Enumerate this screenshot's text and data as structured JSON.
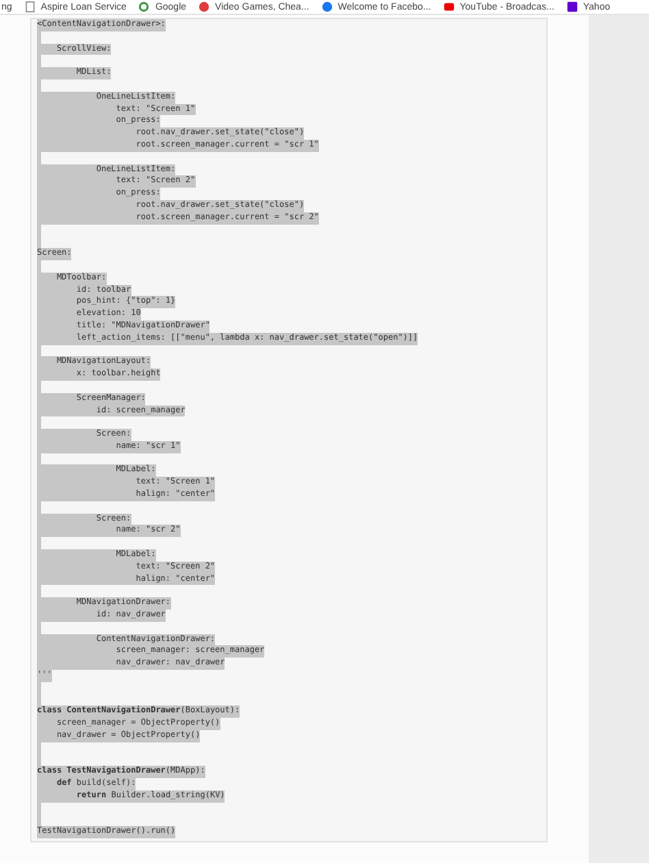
{
  "bookmarks_bar": {
    "items": [
      {
        "label": "ng"
      },
      {
        "label": "Aspire Loan Service"
      },
      {
        "label": "Google"
      },
      {
        "label": "Video Games, Chea..."
      },
      {
        "label": "Welcome to Facebo..."
      },
      {
        "label": "YouTube - Broadcas..."
      },
      {
        "label": "Yahoo"
      }
    ]
  },
  "code_block": {
    "lines": [
      {
        "kind": "code",
        "text": "<ContentNavigationDrawer>:"
      },
      {
        "kind": "blank"
      },
      {
        "kind": "code",
        "text": "    ScrollView:"
      },
      {
        "kind": "blank"
      },
      {
        "kind": "code",
        "text": "        MDList:"
      },
      {
        "kind": "blank"
      },
      {
        "kind": "code",
        "text": "            OneLineListItem:"
      },
      {
        "kind": "code",
        "text": "                text: \"Screen 1\""
      },
      {
        "kind": "code",
        "text": "                on_press:"
      },
      {
        "kind": "code",
        "text": "                    root.nav_drawer.set_state(\"close\")"
      },
      {
        "kind": "code",
        "text": "                    root.screen_manager.current = \"scr 1\""
      },
      {
        "kind": "blank"
      },
      {
        "kind": "code",
        "text": "            OneLineListItem:"
      },
      {
        "kind": "code",
        "text": "                text: \"Screen 2\""
      },
      {
        "kind": "code",
        "text": "                on_press:"
      },
      {
        "kind": "code",
        "text": "                    root.nav_drawer.set_state(\"close\")"
      },
      {
        "kind": "code",
        "text": "                    root.screen_manager.current = \"scr 2\""
      },
      {
        "kind": "blank"
      },
      {
        "kind": "blank"
      },
      {
        "kind": "code",
        "text": "Screen:"
      },
      {
        "kind": "blank"
      },
      {
        "kind": "code",
        "text": "    MDToolbar:"
      },
      {
        "kind": "code",
        "text": "        id: toolbar"
      },
      {
        "kind": "code",
        "text": "        pos_hint: {\"top\": 1}"
      },
      {
        "kind": "code",
        "text": "        elevation: 10"
      },
      {
        "kind": "code",
        "text": "        title: \"MDNavigationDrawer\""
      },
      {
        "kind": "code",
        "text": "        left_action_items: [[\"menu\", lambda x: nav_drawer.set_state(\"open\")]]"
      },
      {
        "kind": "blank"
      },
      {
        "kind": "code",
        "text": "    MDNavigationLayout:"
      },
      {
        "kind": "code",
        "text": "        x: toolbar.height"
      },
      {
        "kind": "blank"
      },
      {
        "kind": "code",
        "text": "        ScreenManager:"
      },
      {
        "kind": "code",
        "text": "            id: screen_manager"
      },
      {
        "kind": "blank"
      },
      {
        "kind": "code",
        "text": "            Screen:"
      },
      {
        "kind": "code",
        "text": "                name: \"scr 1\""
      },
      {
        "kind": "blank"
      },
      {
        "kind": "code",
        "text": "                MDLabel:"
      },
      {
        "kind": "code",
        "text": "                    text: \"Screen 1\""
      },
      {
        "kind": "code",
        "text": "                    halign: \"center\""
      },
      {
        "kind": "blank"
      },
      {
        "kind": "code",
        "text": "            Screen:"
      },
      {
        "kind": "code",
        "text": "                name: \"scr 2\""
      },
      {
        "kind": "blank"
      },
      {
        "kind": "code",
        "text": "                MDLabel:"
      },
      {
        "kind": "code",
        "text": "                    text: \"Screen 2\""
      },
      {
        "kind": "code",
        "text": "                    halign: \"center\""
      },
      {
        "kind": "blank"
      },
      {
        "kind": "code",
        "text": "        MDNavigationDrawer:"
      },
      {
        "kind": "code",
        "text": "            id: nav_drawer"
      },
      {
        "kind": "blank"
      },
      {
        "kind": "code",
        "text": "            ContentNavigationDrawer:"
      },
      {
        "kind": "code",
        "text": "                screen_manager: screen_manager"
      },
      {
        "kind": "code",
        "text": "                nav_drawer: nav_drawer"
      },
      {
        "kind": "code",
        "text": "'''"
      },
      {
        "kind": "blank"
      },
      {
        "kind": "blank"
      },
      {
        "kind": "code",
        "text": "**class ContentNavigationDrawer**(BoxLayout):"
      },
      {
        "kind": "code",
        "text": "    screen_manager = ObjectProperty()"
      },
      {
        "kind": "code",
        "text": "    nav_drawer = ObjectProperty()"
      },
      {
        "kind": "blank"
      },
      {
        "kind": "blank"
      },
      {
        "kind": "code",
        "text": "**class TestNavigationDrawer**(MDApp):"
      },
      {
        "kind": "code",
        "text": "    **def** build(self):"
      },
      {
        "kind": "code",
        "text": "        **return** Builder.load_string(KV)"
      },
      {
        "kind": "blank"
      },
      {
        "kind": "blank"
      },
      {
        "kind": "code",
        "text": "TestNavigationDrawer().run()"
      }
    ]
  }
}
